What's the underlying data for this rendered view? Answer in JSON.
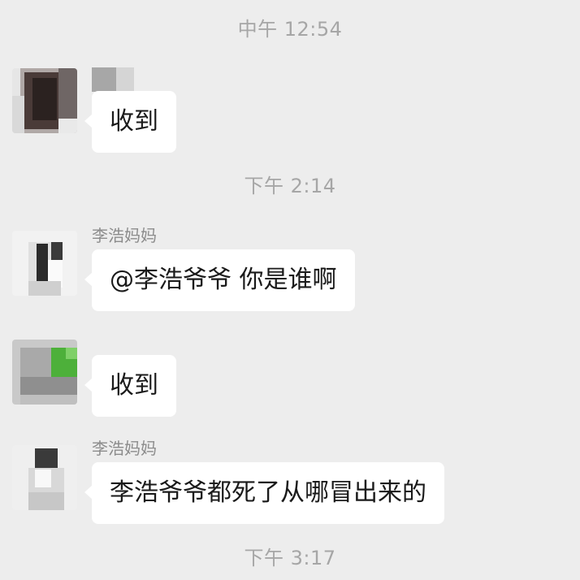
{
  "timestamps": [
    {
      "text": "中午 12:54"
    },
    {
      "text": "下午 2:14"
    },
    {
      "text": "下午 3:17"
    }
  ],
  "messages": [
    {
      "sender": "",
      "text": "收到"
    },
    {
      "sender": "李浩妈妈",
      "text": "@李浩爷爷 你是谁啊"
    },
    {
      "sender": "",
      "text": "收到"
    },
    {
      "sender": "李浩妈妈",
      "text": "李浩爷爷都死了从哪冒出来的"
    }
  ],
  "colors": {
    "background": "#ededed",
    "bubble": "#ffffff",
    "timestamp_text": "#a6a6a6",
    "sender_text": "#8c8c8c"
  }
}
